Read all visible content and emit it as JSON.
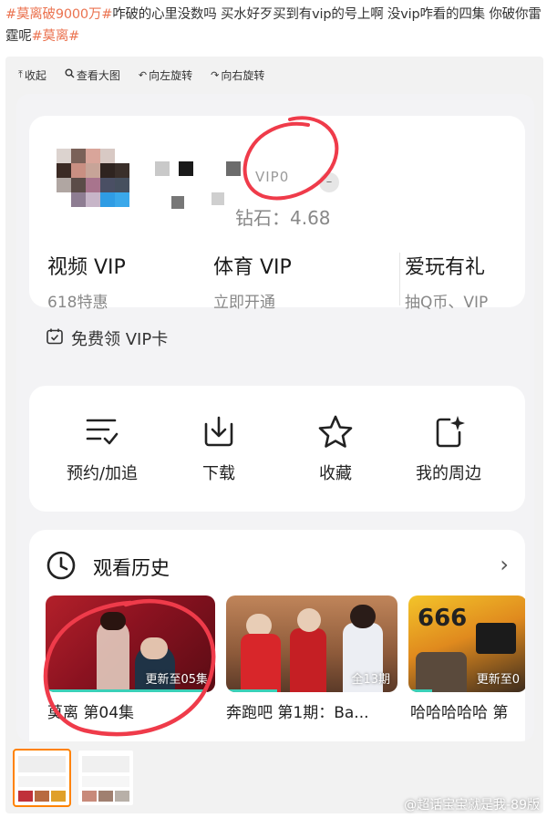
{
  "post": {
    "topic1": "#莫离破9000万#",
    "body": "咋破的心里没数吗 买水好歹买到有vip的号上啊 没vip咋看的四集 你破你雷霆呢",
    "topic2": "#莫离#"
  },
  "toolbar": {
    "collapse": "收起",
    "view_large": "查看大图",
    "rotate_left": "向左旋转",
    "rotate_right": "向右旋转"
  },
  "account": {
    "vip_level": "VIP0",
    "diamond": "钻石：4.68"
  },
  "vip_cols": [
    {
      "title": "视频 VIP",
      "sub": "618特惠"
    },
    {
      "title": "体育 VIP",
      "sub": "立即开通"
    },
    {
      "title": "爱玩有礼",
      "sub": "抽Q币、VIP"
    }
  ],
  "free_vip": "免费领 VIP卡",
  "actions": [
    {
      "label": "预约/加追",
      "icon": "list-check-icon"
    },
    {
      "label": "下载",
      "icon": "download-icon"
    },
    {
      "label": "收藏",
      "icon": "star-icon"
    },
    {
      "label": "我的周边",
      "icon": "sparkle-card-icon"
    }
  ],
  "history": {
    "title": "观看历史",
    "items": [
      {
        "name": "莫离 第04集",
        "badge": "更新至05集",
        "progress": 0.95
      },
      {
        "name": "奔跑吧 第1期：Ba...",
        "badge": "全13期",
        "progress": 0.3
      },
      {
        "name": "哈哈哈哈哈 第",
        "badge": "更新至0",
        "progress": 0.2
      }
    ]
  },
  "watermark": "@超话宝宝就是我-89版",
  "colors": {
    "topic": "#eb7350",
    "annotation": "#ef3b4a",
    "progress": "#3ad0b8"
  }
}
